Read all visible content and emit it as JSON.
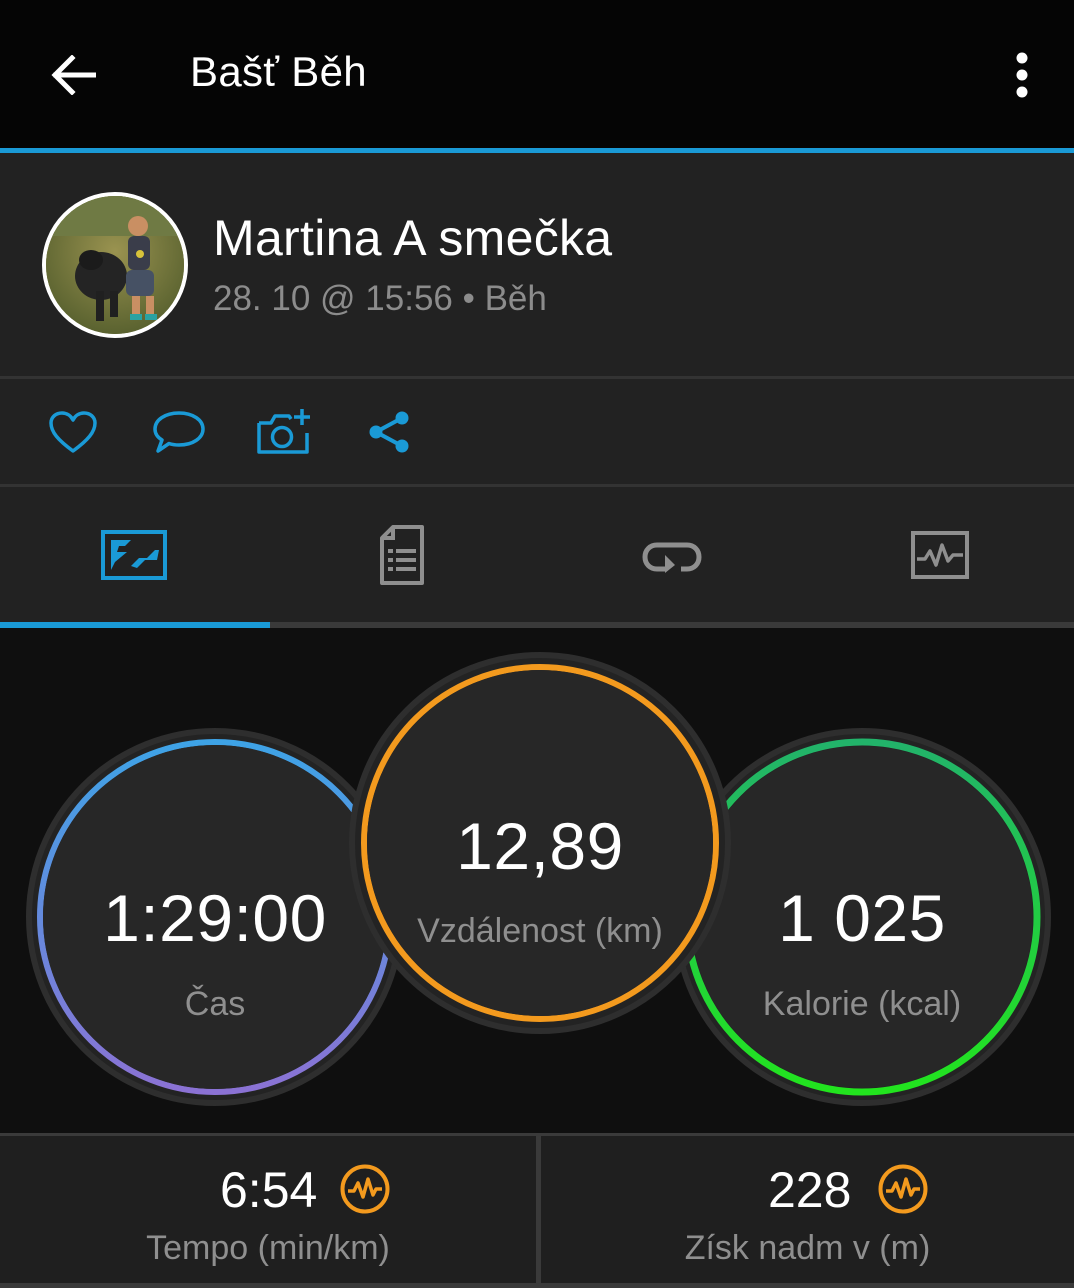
{
  "appbar": {
    "title": "Bašť Běh",
    "back_icon": "arrow-left-icon",
    "menu_icon": "more-vertical-icon"
  },
  "activity": {
    "user_name": "Martina A smečka",
    "meta": "28. 10 @ 15:56 • Běh"
  },
  "actions": [
    {
      "name": "like",
      "icon": "heart-icon"
    },
    {
      "name": "comment",
      "icon": "comment-icon"
    },
    {
      "name": "add-photo",
      "icon": "camera-plus-icon"
    },
    {
      "name": "share",
      "icon": "share-icon"
    }
  ],
  "tabs": [
    {
      "name": "map",
      "icon": "map-icon",
      "active": true
    },
    {
      "name": "details",
      "icon": "document-list-icon",
      "active": false
    },
    {
      "name": "laps",
      "icon": "loop-icon",
      "active": false
    },
    {
      "name": "charts",
      "icon": "chart-icon",
      "active": false
    }
  ],
  "stats": {
    "time": {
      "value": "1:29:00",
      "label": "Čas"
    },
    "distance": {
      "value": "12,89",
      "label": "Vzdálenost (km)"
    },
    "calories": {
      "value": "1 025",
      "label": "Kalorie (kcal)"
    }
  },
  "summary": {
    "pace": {
      "value": "6:54",
      "label": "Tempo (min/km)",
      "icon": "heart-rate-badge-icon"
    },
    "elevation": {
      "value": "228",
      "label": "Získ nadm v (m)",
      "icon": "heart-rate-badge-icon"
    }
  },
  "colors": {
    "accent": "#1a9ad6",
    "time_ring_start": "#3ea3e6",
    "time_ring_end": "#8b72d4",
    "distance_ring": "#f39a1e",
    "calories_ring_start": "#22b36a",
    "calories_ring_end": "#22e41e",
    "badge": "#f39a1e"
  }
}
